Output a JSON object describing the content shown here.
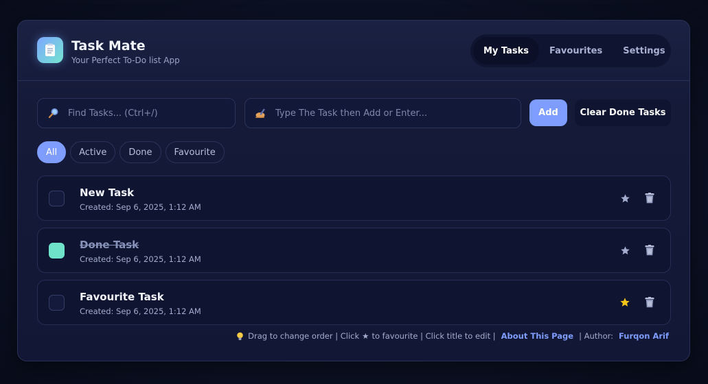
{
  "app": {
    "title": "Task Mate",
    "subtitle": "Your Perfect To-Do list App",
    "logo_icon": "notepad-icon"
  },
  "nav": {
    "items": [
      {
        "label": "My Tasks",
        "active": true
      },
      {
        "label": "Favourites",
        "active": false
      },
      {
        "label": "Settings",
        "active": false
      }
    ]
  },
  "search": {
    "placeholder": "Find Tasks... (Ctrl+/)",
    "value": "",
    "icon": "magnifier-icon"
  },
  "new_task": {
    "placeholder": "Type The Task then Add or Enter...",
    "value": "",
    "icon": "writing-hand-icon"
  },
  "buttons": {
    "add": "Add",
    "clear_done": "Clear Done Tasks"
  },
  "filters": [
    {
      "label": "All",
      "active": true
    },
    {
      "label": "Active",
      "active": false
    },
    {
      "label": "Done",
      "active": false
    },
    {
      "label": "Favourite",
      "active": false
    }
  ],
  "tasks": [
    {
      "title": "New Task",
      "created": "Created: Sep 6, 2025, 1:12 AM",
      "done": false,
      "favourite": false
    },
    {
      "title": "Done Task",
      "created": "Created: Sep 6, 2025, 1:12 AM",
      "done": true,
      "favourite": false
    },
    {
      "title": "Favourite Task",
      "created": "Created: Sep 6, 2025, 1:12 AM",
      "done": false,
      "favourite": true
    }
  ],
  "footer": {
    "hint_part1": "Drag to change order | Click",
    "hint_star": "★",
    "hint_part2": "to favourite | Click title to edit |",
    "about_link": "About This Page",
    "author_label": "| Author:",
    "author_name": "Furqon Arif"
  },
  "colors": {
    "accent": "#7f9dff",
    "done_check": "#6fe3c9",
    "favourite_star": "#f5c518",
    "star_inactive": "#a3acce"
  }
}
